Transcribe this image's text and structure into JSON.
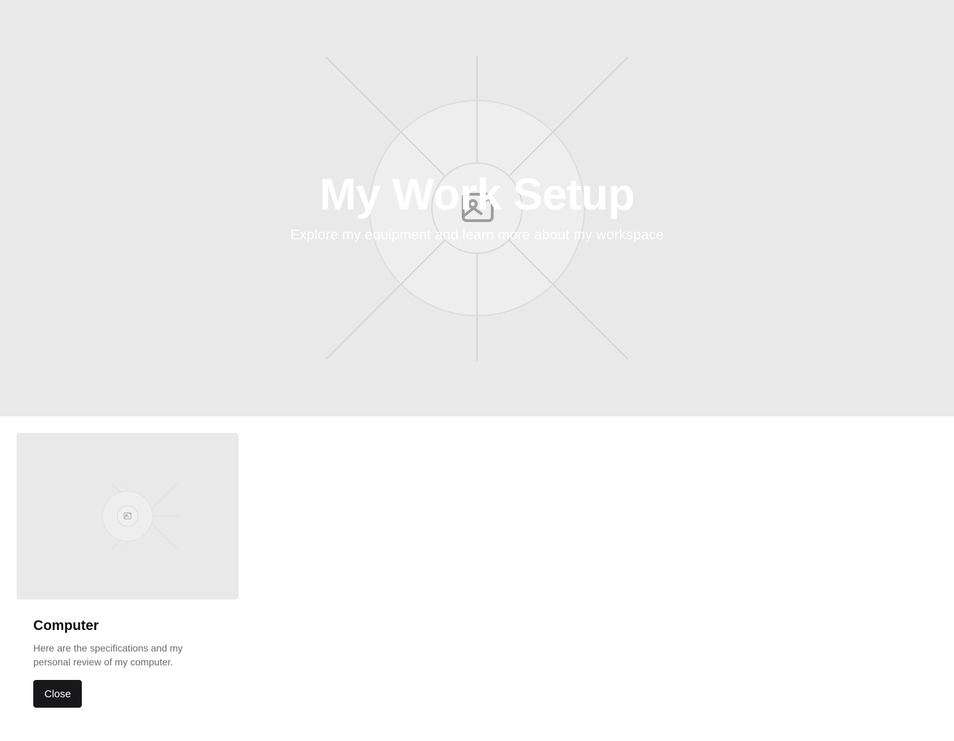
{
  "hero": {
    "title": "My Work Setup",
    "subtitle": "Explore my equipment and learn more about my workspace",
    "image_icon": "image-placeholder-icon"
  },
  "card": {
    "image_icon": "image-placeholder-icon",
    "title": "Computer",
    "description": "Here are the specifications and my personal review of my computer.",
    "close_label": "Close"
  },
  "colors": {
    "placeholder_bg": "#e9e9e9",
    "button_bg": "#18181b",
    "title_text": "#111111",
    "desc_text": "#6b6b6b"
  }
}
